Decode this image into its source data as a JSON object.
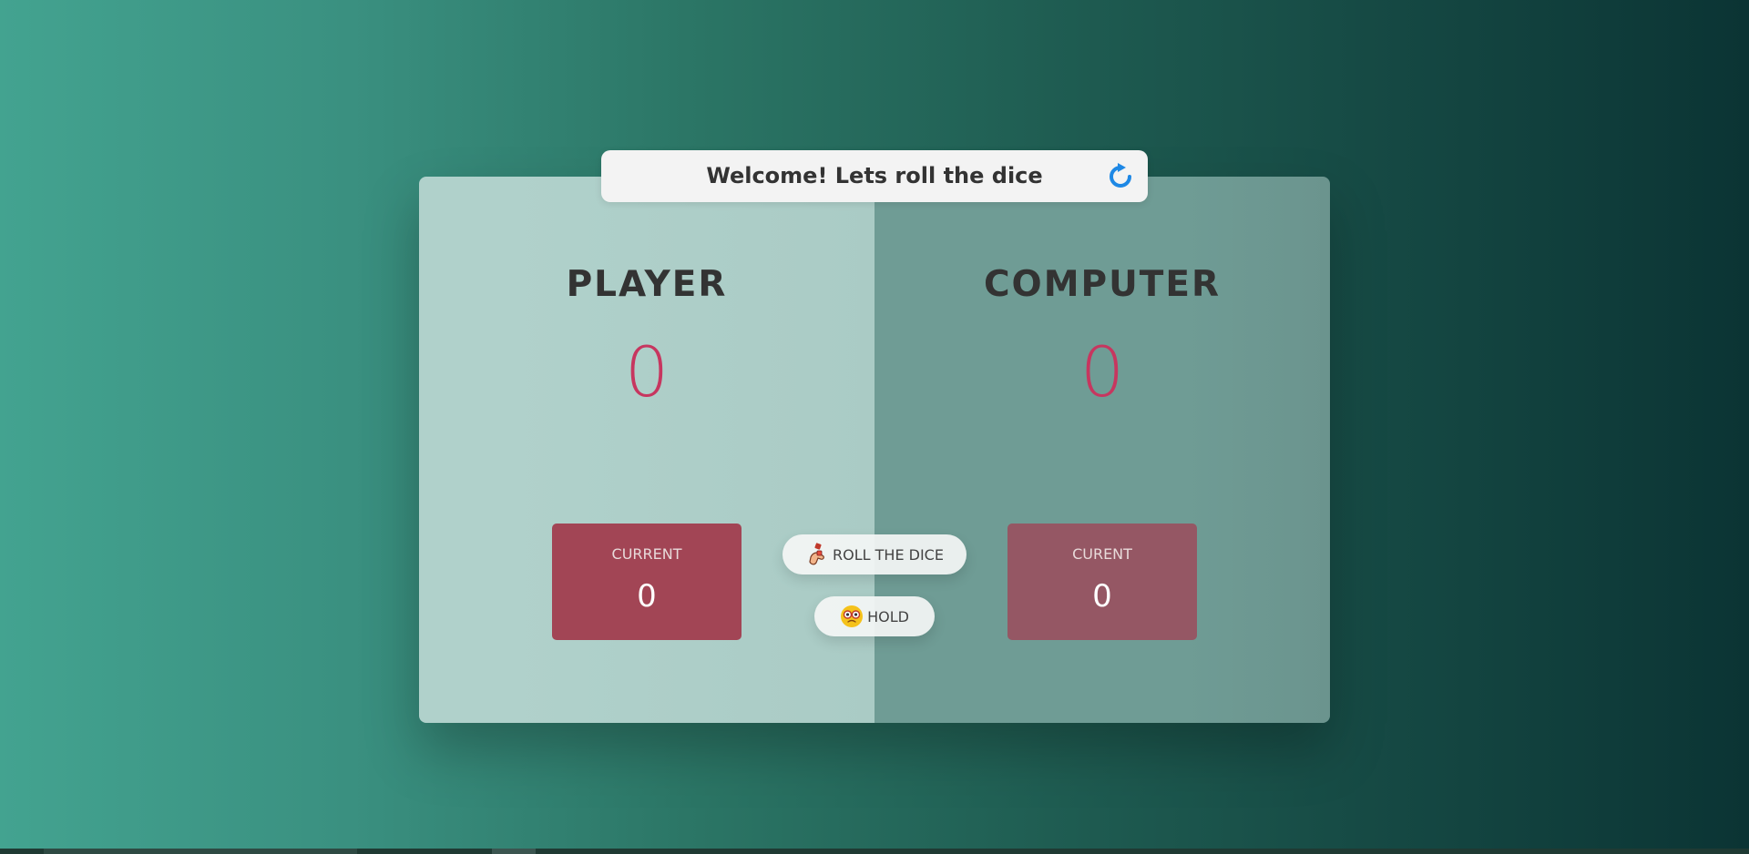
{
  "header": {
    "message": "Welcome! Lets roll the dice",
    "icon": "refresh-icon"
  },
  "player": {
    "name": "PLAYER",
    "score": "0",
    "current_label": "CURRENT",
    "current_value": "0"
  },
  "computer": {
    "name": "COMPUTER",
    "score": "0",
    "current_label": "CURENT",
    "current_value": "0"
  },
  "controls": {
    "roll_label": "ROLL THE DICE",
    "roll_icon": "dice-throw-icon",
    "hold_label": "HOLD",
    "hold_icon": "hold-face-icon"
  },
  "colors": {
    "score": "#c7365f",
    "player_current_bg": "#a24555",
    "computer_current_bg": "#955764",
    "refresh_icon": "#1e88e5"
  }
}
